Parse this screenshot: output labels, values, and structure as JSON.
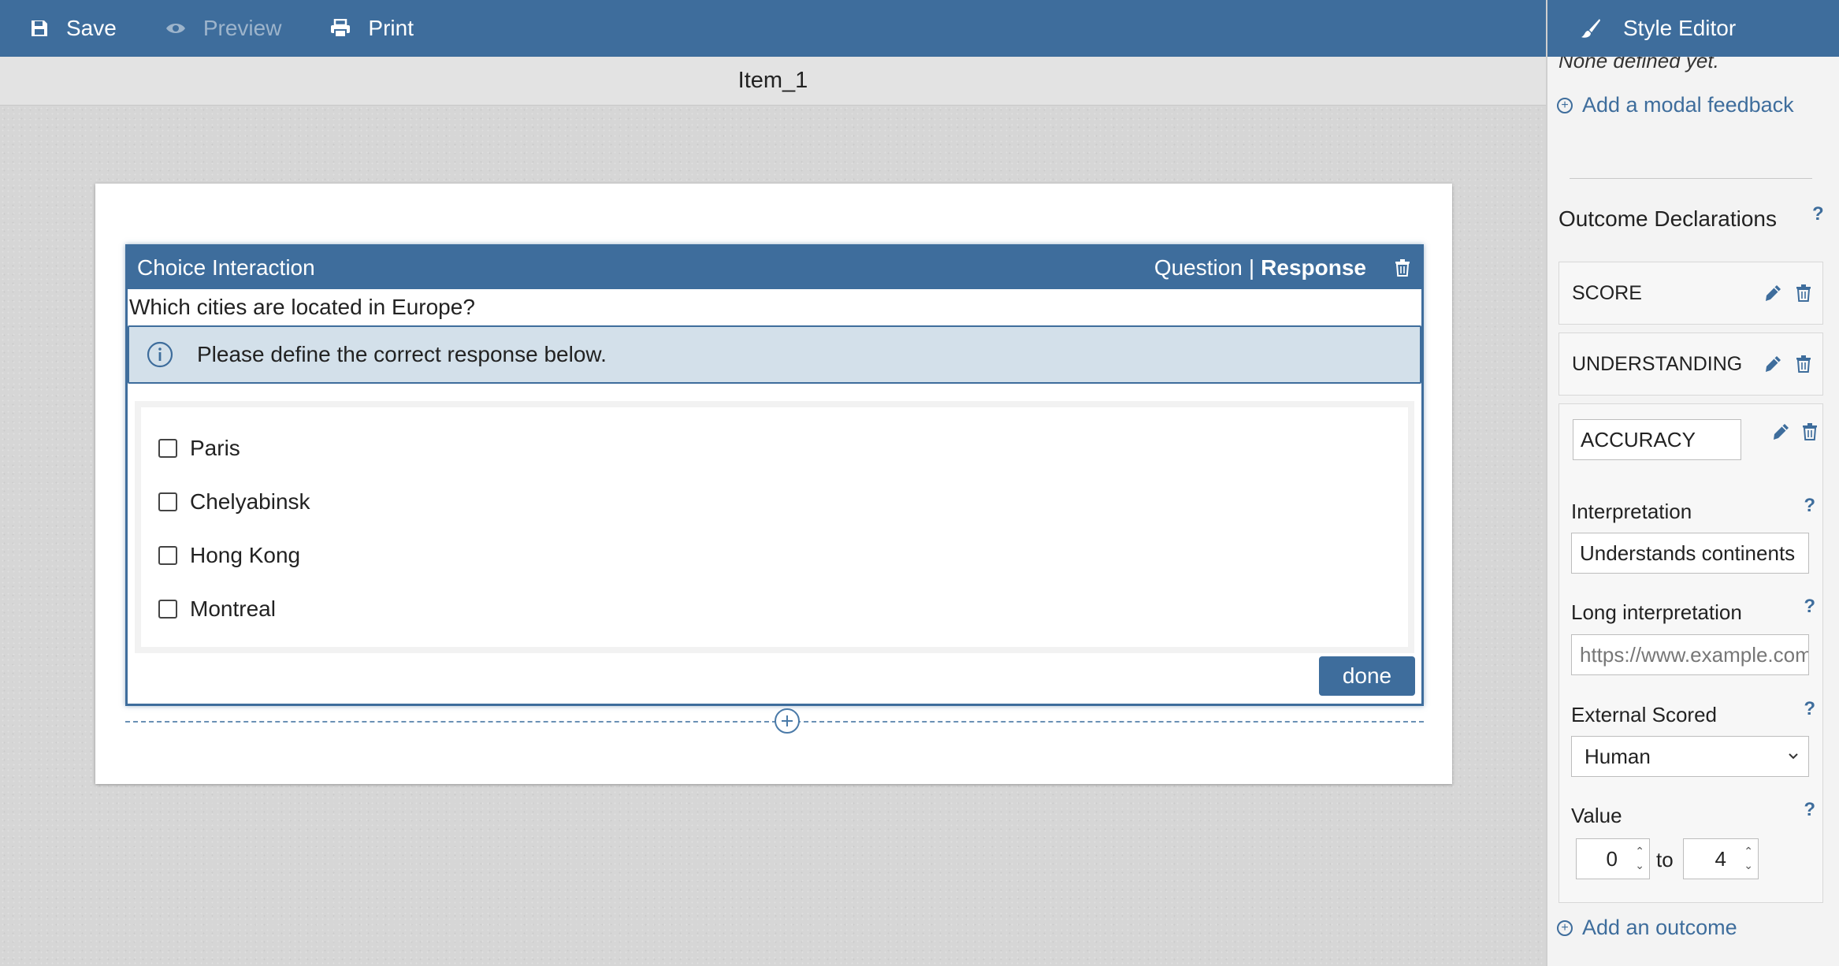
{
  "toolbar": {
    "save_label": "Save",
    "preview_label": "Preview",
    "print_label": "Print"
  },
  "item": {
    "title": "Item_1"
  },
  "interaction": {
    "title": "Choice Interaction",
    "tab_question": "Question",
    "tab_separator": "|",
    "tab_response": "Response",
    "prompt": "Which cities are located in Europe?",
    "info": "Please define the correct response below.",
    "choices": [
      "Paris",
      "Chelyabinsk",
      "Hong Kong",
      "Montreal"
    ],
    "done_label": "done"
  },
  "side": {
    "header": "Style Editor",
    "none_defined": "None defined yet.",
    "add_modal_feedback": "Add a modal feedback",
    "outcome_title": "Outcome Declarations",
    "help_mark": "?",
    "outcomes": [
      "SCORE",
      "UNDERSTANDING",
      "ACCURACY"
    ],
    "interpretation_label": "Interpretation",
    "interpretation_value": "Understands continents",
    "long_interpretation_label": "Long interpretation",
    "long_interpretation_placeholder": "https://www.example.com",
    "external_scored_label": "External Scored",
    "external_scored_value": "Human",
    "value_label": "Value",
    "value_min": "0",
    "value_to": "to",
    "value_max": "4",
    "add_outcome": "Add an outcome"
  },
  "colors": {
    "primary": "#3e6d9c",
    "info_bg": "#d3e0ea"
  }
}
